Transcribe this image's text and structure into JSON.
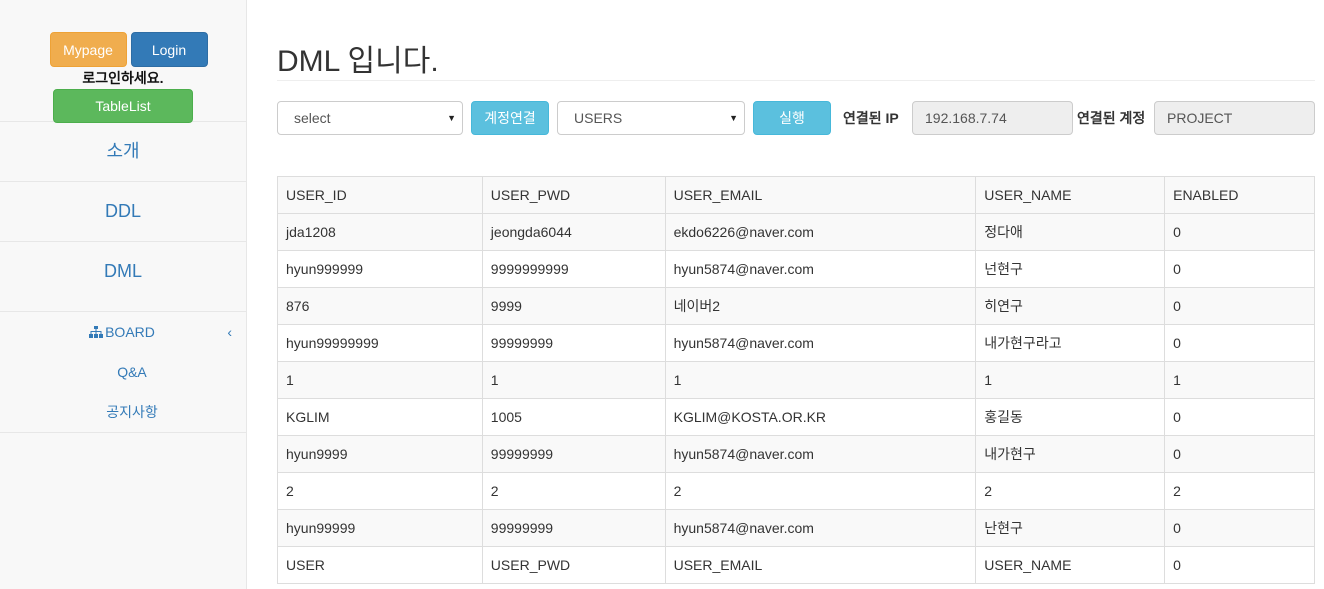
{
  "sidebar": {
    "mypage_label": "Mypage",
    "login_label": "Login",
    "login_msg": "로그인하세요.",
    "tablelist_label": "TableList",
    "nav": {
      "intro": "소개",
      "ddl": "DDL",
      "dml": "DML"
    },
    "board": {
      "label": "BOARD",
      "items": [
        "Q&A",
        "공지사항"
      ]
    }
  },
  "main": {
    "title": "DML 입니다.",
    "toolbar": {
      "command_select": "select",
      "connect_button": "계정연결",
      "table_select": "USERS",
      "execute_button": "실행",
      "ip_label": "연결된 IP",
      "ip_value": "192.168.7.74",
      "account_label": "연결된 계정",
      "account_value": "PROJECT"
    },
    "table": {
      "headers": [
        "USER_ID",
        "USER_PWD",
        "USER_EMAIL",
        "USER_NAME",
        "ENABLED"
      ],
      "rows": [
        [
          "jda1208",
          "jeongda6044",
          "ekdo6226@naver.com",
          "정다애",
          "0"
        ],
        [
          "hyun999999",
          "9999999999",
          "hyun5874@naver.com",
          "넌현구",
          "0"
        ],
        [
          "876",
          "9999",
          "네이버2",
          "히연구",
          "0"
        ],
        [
          "hyun99999999",
          "99999999",
          "hyun5874@naver.com",
          "내가현구라고",
          "0"
        ],
        [
          "1",
          "1",
          "1",
          "1",
          "1"
        ],
        [
          "KGLIM",
          "1005",
          "KGLIM@KOSTA.OR.KR",
          "홍길동",
          "0"
        ],
        [
          "hyun9999",
          "99999999",
          "hyun5874@naver.com",
          "내가현구",
          "0"
        ],
        [
          "2",
          "2",
          "2",
          "2",
          "2"
        ],
        [
          "hyun99999",
          "99999999",
          "hyun5874@naver.com",
          "난현구",
          "0"
        ],
        [
          "USER",
          "USER_PWD",
          "USER_EMAIL",
          "USER_NAME",
          "0"
        ]
      ]
    }
  },
  "colors": {
    "primary": "#337ab7",
    "warning": "#f0ad4e",
    "success": "#5cb85c",
    "info": "#5bc0de"
  }
}
